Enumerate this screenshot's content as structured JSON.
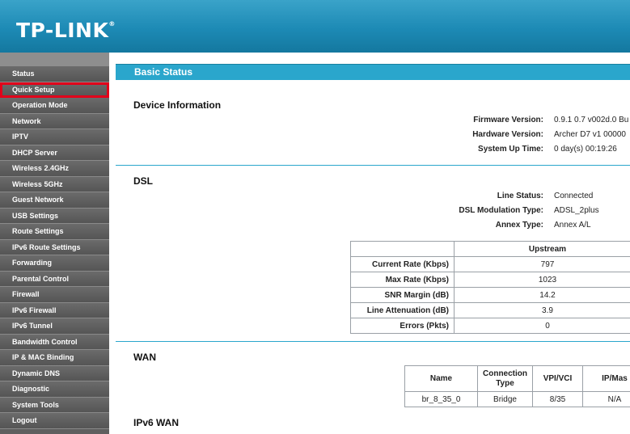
{
  "brand": {
    "logo": "TP-LINK",
    "reg": "®"
  },
  "menu": [
    {
      "label": "Status"
    },
    {
      "label": "Quick Setup"
    },
    {
      "label": "Operation Mode"
    },
    {
      "label": "Network"
    },
    {
      "label": "IPTV"
    },
    {
      "label": "DHCP Server"
    },
    {
      "label": "Wireless 2.4GHz"
    },
    {
      "label": "Wireless 5GHz"
    },
    {
      "label": "Guest Network"
    },
    {
      "label": "USB Settings"
    },
    {
      "label": "Route Settings"
    },
    {
      "label": "IPv6 Route Settings"
    },
    {
      "label": "Forwarding"
    },
    {
      "label": "Parental Control"
    },
    {
      "label": "Firewall"
    },
    {
      "label": "IPv6 Firewall"
    },
    {
      "label": "IPv6 Tunnel"
    },
    {
      "label": "Bandwidth Control"
    },
    {
      "label": "IP & MAC Binding"
    },
    {
      "label": "Dynamic DNS"
    },
    {
      "label": "Diagnostic"
    },
    {
      "label": "System Tools"
    },
    {
      "label": "Logout"
    }
  ],
  "page": {
    "title": "Basic Status"
  },
  "device": {
    "heading": "Device Information",
    "fw_label": "Firmware Version:",
    "fw_value": "0.9.1 0.7 v002d.0 Bu",
    "hw_label": "Hardware Version:",
    "hw_value": "Archer D7 v1 00000",
    "up_label": "System Up Time:",
    "up_value": "0 day(s) 00:19:26"
  },
  "dsl": {
    "heading": "DSL",
    "status_label": "Line Status:",
    "status_value": "Connected",
    "mod_label": "DSL Modulation Type:",
    "mod_value": "ADSL_2plus",
    "annex_label": "Annex Type:",
    "annex_value": "Annex A/L",
    "table": {
      "col_upstream": "Upstream",
      "rows": [
        {
          "label": "Current Rate (Kbps)",
          "upstream": "797"
        },
        {
          "label": "Max Rate (Kbps)",
          "upstream": "1023"
        },
        {
          "label": "SNR Margin (dB)",
          "upstream": "14.2"
        },
        {
          "label": "Line Attenuation (dB)",
          "upstream": "3.9"
        },
        {
          "label": "Errors (Pkts)",
          "upstream": "0"
        }
      ]
    }
  },
  "wan": {
    "heading": "WAN",
    "headers": {
      "name": "Name",
      "conn": "Connection Type",
      "vpi": "VPI/VCI",
      "ip": "IP/Mas"
    },
    "row": {
      "name": "br_8_35_0",
      "conn": "Bridge",
      "vpi": "8/35",
      "ip": "N/A"
    }
  },
  "ipv6wan": {
    "heading": "IPv6 WAN"
  },
  "colors": {
    "header": "#1d8ab5",
    "accent": "#2aa6cc",
    "sidebar": "#5f5f5f",
    "highlight": "#e2001a"
  }
}
